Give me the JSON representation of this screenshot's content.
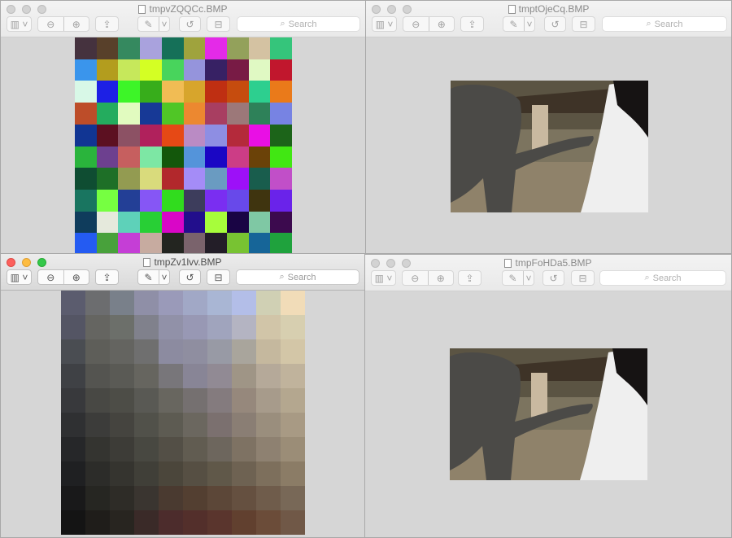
{
  "windows": [
    {
      "title": "tmpvZQQCc.BMP",
      "active": false
    },
    {
      "title": "tmptOjeCq.BMP",
      "active": false
    },
    {
      "title": "tmpZv1lvv.BMP",
      "active": true
    },
    {
      "title": "tmpFoHDa5.BMP",
      "active": false
    }
  ],
  "toolbar": {
    "search_placeholder": "Search",
    "icons": [
      "sidebar-icon",
      "zoom-out-icon",
      "zoom-in-icon",
      "share-icon",
      "markup-pen-icon",
      "rotate-icon",
      "toolbox-icon"
    ]
  },
  "images": {
    "color_grid": [
      [
        "#45323e",
        "#58402a",
        "#35895f",
        "#a9a2dd",
        "#157058",
        "#9fa33d",
        "#e42ae8",
        "#93a15b",
        "#d4c2a2",
        "#35c57b"
      ],
      [
        "#3a95ec",
        "#b39d1e",
        "#c6e85b",
        "#d4ff24",
        "#48d45c",
        "#9594dc",
        "#372164",
        "#781b45",
        "#e0f9c3",
        "#c1172d"
      ],
      [
        "#d8f8e7",
        "#1d20e5",
        "#3df528",
        "#37ad1b",
        "#f1bc54",
        "#d7a52c",
        "#bf2f12",
        "#c64c0e",
        "#2dcf8f",
        "#ea7a1a"
      ],
      [
        "#bd4d29",
        "#24ac5e",
        "#e1fbbf",
        "#173996",
        "#50c626",
        "#ec8830",
        "#a83e61",
        "#9c7879",
        "#2e8159",
        "#7783e3"
      ],
      [
        "#113593",
        "#5c1021",
        "#8c5164",
        "#b0215c",
        "#e64915",
        "#ba8bc4",
        "#8e8ee3",
        "#b42a3b",
        "#e90fe5",
        "#1c6419"
      ],
      [
        "#2ab43c",
        "#6d408f",
        "#c65f5f",
        "#7de7a4",
        "#13570b",
        "#5494da",
        "#1a06c4",
        "#cc3d86",
        "#6b4208",
        "#41e713"
      ],
      [
        "#0f4d32",
        "#1e6f27",
        "#939b51",
        "#d9db7c",
        "#b2282c",
        "#a48cf7",
        "#6a9bc1",
        "#9d10f8",
        "#195d4d",
        "#c14fc8"
      ],
      [
        "#197560",
        "#76ff41",
        "#233f96",
        "#8656f5",
        "#31dc1e",
        "#3d3d5c",
        "#7a2ef1",
        "#6849ea",
        "#3f340f",
        "#6a23ea"
      ],
      [
        "#0f3c5c",
        "#e5e9dc",
        "#5ed1b9",
        "#28cf35",
        "#d906c7",
        "#220e8c",
        "#a7fd3b",
        "#190444",
        "#7fc8a4",
        "#3c0a4e"
      ],
      [
        "#245bf2",
        "#48a13b",
        "#c53ed6",
        "#c7aba0",
        "#232520",
        "#7a636c",
        "#231e28",
        "#78c332",
        "#166598",
        "#1fa23d"
      ]
    ],
    "pixelated": [
      [
        "#5b5c6e",
        "#6c6d6f",
        "#79808a",
        "#8f8fa7",
        "#9a9ab9",
        "#a1a8c6",
        "#a9b6d4",
        "#b3bee8",
        "#d0d0b4",
        "#f1dcb8"
      ],
      [
        "#545564",
        "#656561",
        "#6c6f6a",
        "#80818c",
        "#9191a8",
        "#9898b4",
        "#a0a4bd",
        "#b4b4c2",
        "#d1c5a8",
        "#d7cfb0"
      ],
      [
        "#4a4d52",
        "#5e5e59",
        "#646460",
        "#6f6f6f",
        "#8c8ba0",
        "#8f8ea0",
        "#989aa5",
        "#a9a59c",
        "#c5b89e",
        "#d3c6a7"
      ],
      [
        "#3f4145",
        "#545450",
        "#5a5a55",
        "#66655f",
        "#78767a",
        "#888596",
        "#918a94",
        "#9f9586",
        "#b5a999",
        "#c0b39c"
      ],
      [
        "#38393c",
        "#484844",
        "#4d4d47",
        "#595954",
        "#68665f",
        "#757070",
        "#847b7e",
        "#96887c",
        "#a79b8b",
        "#b4a78f"
      ],
      [
        "#2f3032",
        "#3c3c3a",
        "#45443f",
        "#51514a",
        "#5d5b52",
        "#6b675f",
        "#7b706f",
        "#8a7e74",
        "#9a8e7d",
        "#a89a84"
      ],
      [
        "#262729",
        "#343430",
        "#3d3c37",
        "#484841",
        "#534f46",
        "#615c51",
        "#6d665d",
        "#7e7263",
        "#8e8171",
        "#9b8d77"
      ],
      [
        "#1f2022",
        "#2c2c29",
        "#35342f",
        "#403f38",
        "#4b463b",
        "#564f43",
        "#605849",
        "#6e6252",
        "#7d6f5c",
        "#8b7c66"
      ],
      [
        "#19191a",
        "#262622",
        "#2e2c27",
        "#3a3530",
        "#4a3a30",
        "#533f31",
        "#5c4738",
        "#655040",
        "#6f5c4b",
        "#786857"
      ],
      [
        "#141414",
        "#1f1d1a",
        "#282520",
        "#3a2a28",
        "#4c2c2c",
        "#532f2b",
        "#5a352d",
        "#61402f",
        "#6b4c39",
        "#705847"
      ]
    ]
  }
}
